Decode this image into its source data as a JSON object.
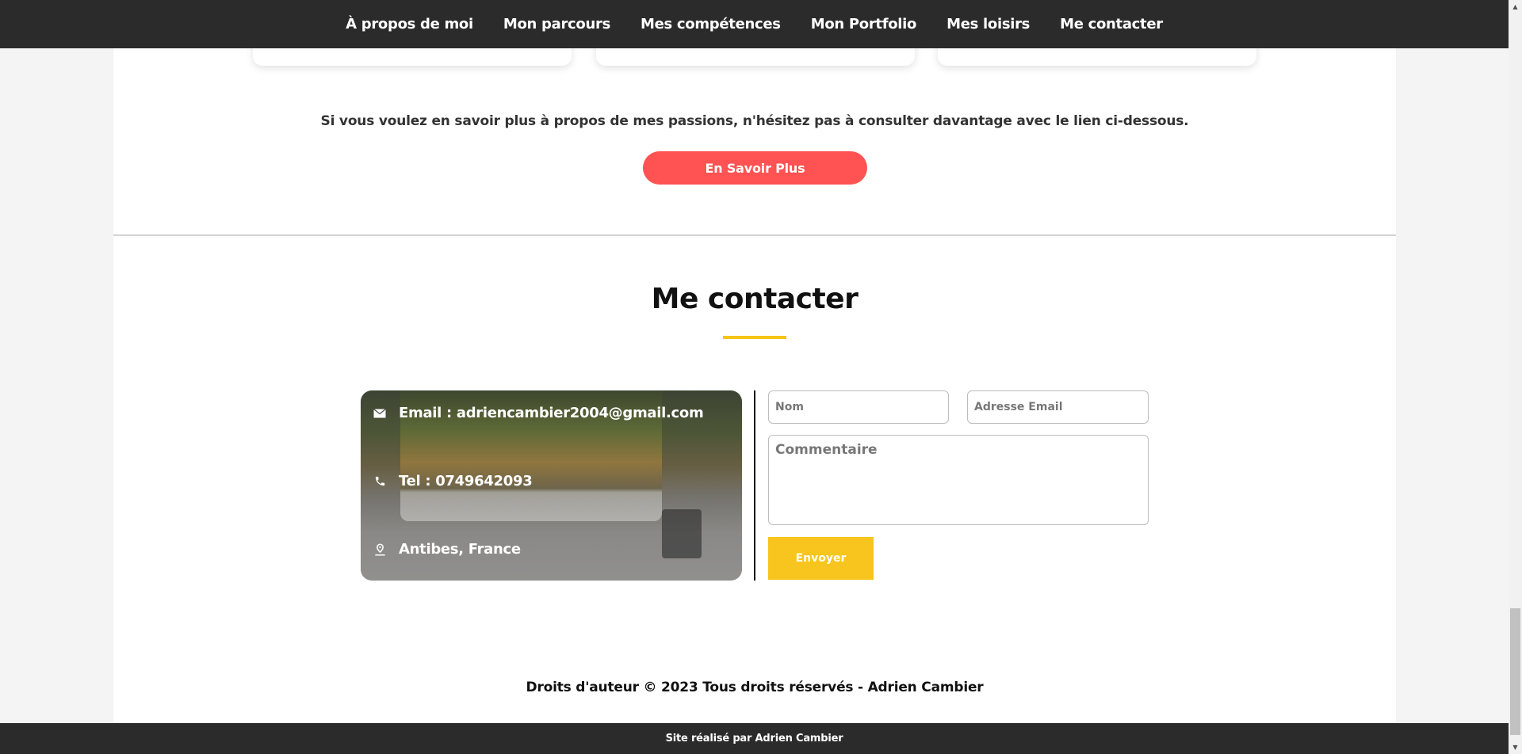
{
  "nav": {
    "items": [
      {
        "label": "À propos de moi"
      },
      {
        "label": "Mon parcours"
      },
      {
        "label": "Mes compétences"
      },
      {
        "label": "Mon Portfolio"
      },
      {
        "label": "Mes loisirs"
      },
      {
        "label": "Me contacter"
      }
    ]
  },
  "loisirs": {
    "intro_text": "Si vous voulez en savoir plus à propos de mes passions, n'hésitez pas à consulter davantage avec le lien ci-dessous.",
    "more_button_label": "En Savoir Plus"
  },
  "contact": {
    "title": "Me contacter",
    "email_text": "Email : adriencambier2004@gmail.com",
    "phone_text": "Tel : 0749642093",
    "location_text": "Antibes, France",
    "form": {
      "name_placeholder": "Nom",
      "email_placeholder": "Adresse Email",
      "comment_placeholder": "Commentaire",
      "submit_label": "Envoyer"
    }
  },
  "copyright": "Droits d'auteur © 2023 Tous droits réservés - Adrien Cambier",
  "footer_text": "Site réalisé par Adrien Cambier",
  "colors": {
    "nav_bg": "#2b2b2b",
    "accent_red": "#ff5252",
    "accent_yellow": "#f7c51d"
  },
  "icons": {
    "email": "envelope-icon",
    "phone": "phone-icon",
    "location": "map-pin-icon"
  }
}
